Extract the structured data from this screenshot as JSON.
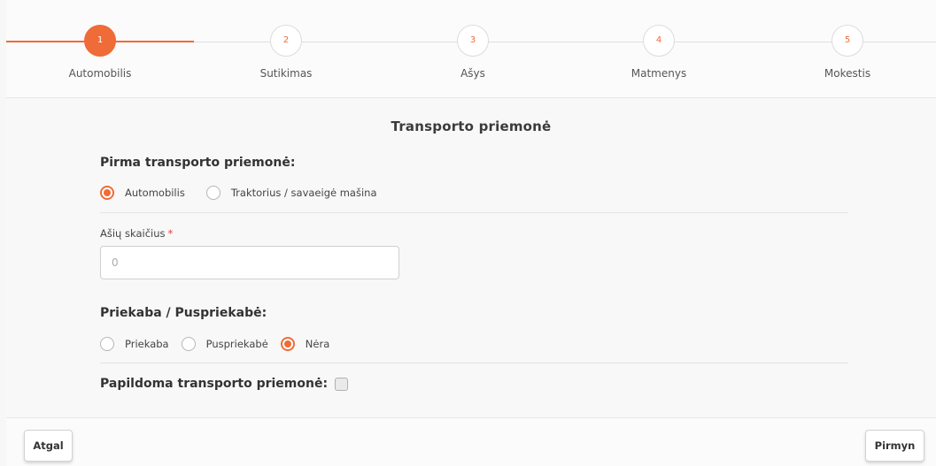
{
  "stepper": {
    "steps": [
      {
        "number": "1",
        "label": "Automobilis",
        "active": true
      },
      {
        "number": "2",
        "label": "Sutikimas",
        "active": false
      },
      {
        "number": "3",
        "label": "Ašys",
        "active": false
      },
      {
        "number": "4",
        "label": "Matmenys",
        "active": false
      },
      {
        "number": "5",
        "label": "Mokestis",
        "active": false
      }
    ]
  },
  "form": {
    "title": "Transporto priemonė",
    "first_vehicle": {
      "heading": "Pirma transporto priemonė:",
      "options": [
        {
          "label": "Automobilis",
          "checked": true
        },
        {
          "label": "Traktorius / savaeigė mašina",
          "checked": false
        }
      ]
    },
    "axles": {
      "label": "Ašių skaičius",
      "required_mark": "*",
      "value": "",
      "placeholder": "0"
    },
    "trailer": {
      "heading": "Priekaba / Puspriekabė:",
      "options": [
        {
          "label": "Priekaba",
          "checked": false
        },
        {
          "label": "Puspriekabė",
          "checked": false
        },
        {
          "label": "Nėra",
          "checked": true
        }
      ]
    },
    "additional_vehicle": {
      "label": "Papildoma transporto priemonė:",
      "checked": false
    }
  },
  "footer": {
    "back_label": "Atgal",
    "next_label": "Pirmyn"
  },
  "colors": {
    "accent": "#ef6b37",
    "required": "#e0413a"
  }
}
